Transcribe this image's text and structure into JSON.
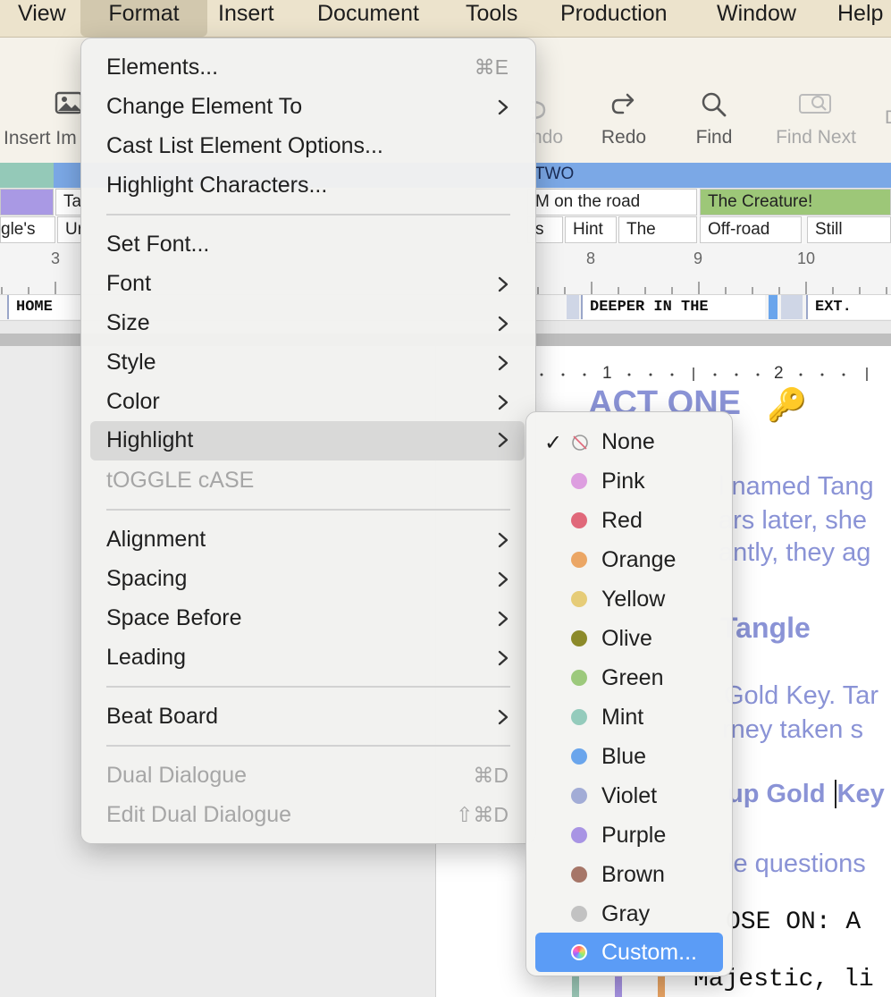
{
  "menubar": {
    "items": [
      {
        "label": "View"
      },
      {
        "label": "Format"
      },
      {
        "label": "Insert"
      },
      {
        "label": "Document"
      },
      {
        "label": "Tools"
      },
      {
        "label": "Production"
      },
      {
        "label": "Window"
      },
      {
        "label": "Help"
      }
    ]
  },
  "toolbar": {
    "insert_image": "Insert Im",
    "undo": "ndo",
    "redo": "Redo",
    "find": "Find",
    "find_next": "Find Next",
    "cutoff": "D"
  },
  "timeline": {
    "act_label": "TWO",
    "row1": [
      "Ta",
      "M on the road",
      "The Creature!"
    ],
    "row2": [
      "gle's",
      "Ur",
      "s",
      "Hint",
      "The",
      "Off-road",
      "Still"
    ],
    "ruler_numbers": [
      "3",
      "8",
      "9",
      "10"
    ],
    "scenes": [
      "HOME",
      "DEEPER IN THE",
      "EXT."
    ]
  },
  "doc_ruler": {
    "numbers": [
      "1",
      "2"
    ]
  },
  "document": {
    "act_heading": "ACT ONE",
    "act_emoji": "🔑",
    "line1": "l named Tang",
    "line2": "ars later, she",
    "line3": "antly, they ag",
    "heading2": "Tangle",
    "line4": "Gold Key. Tar",
    "line5": "rney taken s",
    "heading3a": "up Gold ",
    "heading3b": "Key",
    "line6": "le questions",
    "mono1": "OSE ON: A",
    "mono2": "Majestic, li"
  },
  "format_menu": {
    "items": [
      {
        "label": "Elements...",
        "shortcut": "⌘E"
      },
      {
        "label": "Change Element To"
      },
      {
        "label": "Cast List Element Options..."
      },
      {
        "label": "Highlight Characters..."
      },
      {
        "label": "Set Font..."
      },
      {
        "label": "Font"
      },
      {
        "label": "Size"
      },
      {
        "label": "Style"
      },
      {
        "label": "Color"
      },
      {
        "label": "Highlight"
      },
      {
        "label": "tOGGLE cASE"
      },
      {
        "label": "Alignment"
      },
      {
        "label": "Spacing"
      },
      {
        "label": "Space Before"
      },
      {
        "label": "Leading"
      },
      {
        "label": "Beat Board"
      },
      {
        "label": "Dual Dialogue",
        "shortcut": "⌘D"
      },
      {
        "label": "Edit Dual Dialogue",
        "shortcut": "⇧⌘D"
      }
    ]
  },
  "highlight_menu": {
    "items": [
      {
        "label": "None",
        "checked": true
      },
      {
        "label": "Pink",
        "color": "#dd9ee0"
      },
      {
        "label": "Red",
        "color": "#e0687a"
      },
      {
        "label": "Orange",
        "color": "#eba665"
      },
      {
        "label": "Yellow",
        "color": "#e6cc78"
      },
      {
        "label": "Olive",
        "color": "#8c8a2a"
      },
      {
        "label": "Green",
        "color": "#9cc97c"
      },
      {
        "label": "Mint",
        "color": "#94cbbc"
      },
      {
        "label": "Blue",
        "color": "#6aa5ec"
      },
      {
        "label": "Violet",
        "color": "#a2acd6"
      },
      {
        "label": "Purple",
        "color": "#a894e4"
      },
      {
        "label": "Brown",
        "color": "#a67668"
      },
      {
        "label": "Gray",
        "color": "#c2c2c2"
      },
      {
        "label": "Custom...",
        "selected": true
      }
    ]
  }
}
